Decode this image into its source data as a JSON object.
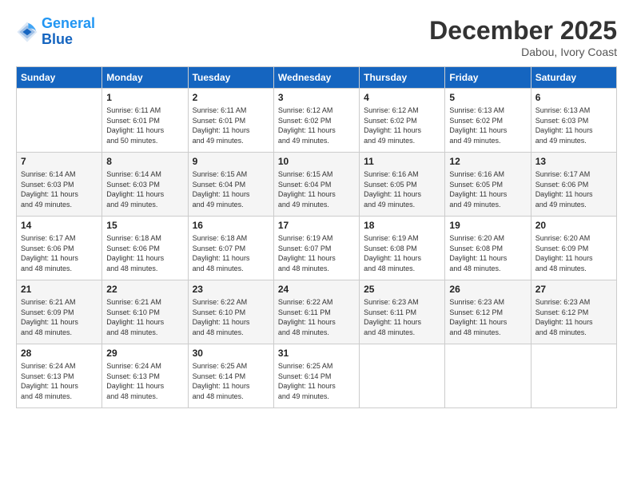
{
  "header": {
    "logo_line1": "General",
    "logo_line2": "Blue",
    "month": "December 2025",
    "location": "Dabou, Ivory Coast"
  },
  "days_of_week": [
    "Sunday",
    "Monday",
    "Tuesday",
    "Wednesday",
    "Thursday",
    "Friday",
    "Saturday"
  ],
  "weeks": [
    [
      {
        "day": "",
        "info": ""
      },
      {
        "day": "1",
        "info": "Sunrise: 6:11 AM\nSunset: 6:01 PM\nDaylight: 11 hours\nand 50 minutes."
      },
      {
        "day": "2",
        "info": "Sunrise: 6:11 AM\nSunset: 6:01 PM\nDaylight: 11 hours\nand 49 minutes."
      },
      {
        "day": "3",
        "info": "Sunrise: 6:12 AM\nSunset: 6:02 PM\nDaylight: 11 hours\nand 49 minutes."
      },
      {
        "day": "4",
        "info": "Sunrise: 6:12 AM\nSunset: 6:02 PM\nDaylight: 11 hours\nand 49 minutes."
      },
      {
        "day": "5",
        "info": "Sunrise: 6:13 AM\nSunset: 6:02 PM\nDaylight: 11 hours\nand 49 minutes."
      },
      {
        "day": "6",
        "info": "Sunrise: 6:13 AM\nSunset: 6:03 PM\nDaylight: 11 hours\nand 49 minutes."
      }
    ],
    [
      {
        "day": "7",
        "info": "Sunrise: 6:14 AM\nSunset: 6:03 PM\nDaylight: 11 hours\nand 49 minutes."
      },
      {
        "day": "8",
        "info": "Sunrise: 6:14 AM\nSunset: 6:03 PM\nDaylight: 11 hours\nand 49 minutes."
      },
      {
        "day": "9",
        "info": "Sunrise: 6:15 AM\nSunset: 6:04 PM\nDaylight: 11 hours\nand 49 minutes."
      },
      {
        "day": "10",
        "info": "Sunrise: 6:15 AM\nSunset: 6:04 PM\nDaylight: 11 hours\nand 49 minutes."
      },
      {
        "day": "11",
        "info": "Sunrise: 6:16 AM\nSunset: 6:05 PM\nDaylight: 11 hours\nand 49 minutes."
      },
      {
        "day": "12",
        "info": "Sunrise: 6:16 AM\nSunset: 6:05 PM\nDaylight: 11 hours\nand 49 minutes."
      },
      {
        "day": "13",
        "info": "Sunrise: 6:17 AM\nSunset: 6:06 PM\nDaylight: 11 hours\nand 49 minutes."
      }
    ],
    [
      {
        "day": "14",
        "info": "Sunrise: 6:17 AM\nSunset: 6:06 PM\nDaylight: 11 hours\nand 48 minutes."
      },
      {
        "day": "15",
        "info": "Sunrise: 6:18 AM\nSunset: 6:06 PM\nDaylight: 11 hours\nand 48 minutes."
      },
      {
        "day": "16",
        "info": "Sunrise: 6:18 AM\nSunset: 6:07 PM\nDaylight: 11 hours\nand 48 minutes."
      },
      {
        "day": "17",
        "info": "Sunrise: 6:19 AM\nSunset: 6:07 PM\nDaylight: 11 hours\nand 48 minutes."
      },
      {
        "day": "18",
        "info": "Sunrise: 6:19 AM\nSunset: 6:08 PM\nDaylight: 11 hours\nand 48 minutes."
      },
      {
        "day": "19",
        "info": "Sunrise: 6:20 AM\nSunset: 6:08 PM\nDaylight: 11 hours\nand 48 minutes."
      },
      {
        "day": "20",
        "info": "Sunrise: 6:20 AM\nSunset: 6:09 PM\nDaylight: 11 hours\nand 48 minutes."
      }
    ],
    [
      {
        "day": "21",
        "info": "Sunrise: 6:21 AM\nSunset: 6:09 PM\nDaylight: 11 hours\nand 48 minutes."
      },
      {
        "day": "22",
        "info": "Sunrise: 6:21 AM\nSunset: 6:10 PM\nDaylight: 11 hours\nand 48 minutes."
      },
      {
        "day": "23",
        "info": "Sunrise: 6:22 AM\nSunset: 6:10 PM\nDaylight: 11 hours\nand 48 minutes."
      },
      {
        "day": "24",
        "info": "Sunrise: 6:22 AM\nSunset: 6:11 PM\nDaylight: 11 hours\nand 48 minutes."
      },
      {
        "day": "25",
        "info": "Sunrise: 6:23 AM\nSunset: 6:11 PM\nDaylight: 11 hours\nand 48 minutes."
      },
      {
        "day": "26",
        "info": "Sunrise: 6:23 AM\nSunset: 6:12 PM\nDaylight: 11 hours\nand 48 minutes."
      },
      {
        "day": "27",
        "info": "Sunrise: 6:23 AM\nSunset: 6:12 PM\nDaylight: 11 hours\nand 48 minutes."
      }
    ],
    [
      {
        "day": "28",
        "info": "Sunrise: 6:24 AM\nSunset: 6:13 PM\nDaylight: 11 hours\nand 48 minutes."
      },
      {
        "day": "29",
        "info": "Sunrise: 6:24 AM\nSunset: 6:13 PM\nDaylight: 11 hours\nand 48 minutes."
      },
      {
        "day": "30",
        "info": "Sunrise: 6:25 AM\nSunset: 6:14 PM\nDaylight: 11 hours\nand 48 minutes."
      },
      {
        "day": "31",
        "info": "Sunrise: 6:25 AM\nSunset: 6:14 PM\nDaylight: 11 hours\nand 49 minutes."
      },
      {
        "day": "",
        "info": ""
      },
      {
        "day": "",
        "info": ""
      },
      {
        "day": "",
        "info": ""
      }
    ]
  ]
}
